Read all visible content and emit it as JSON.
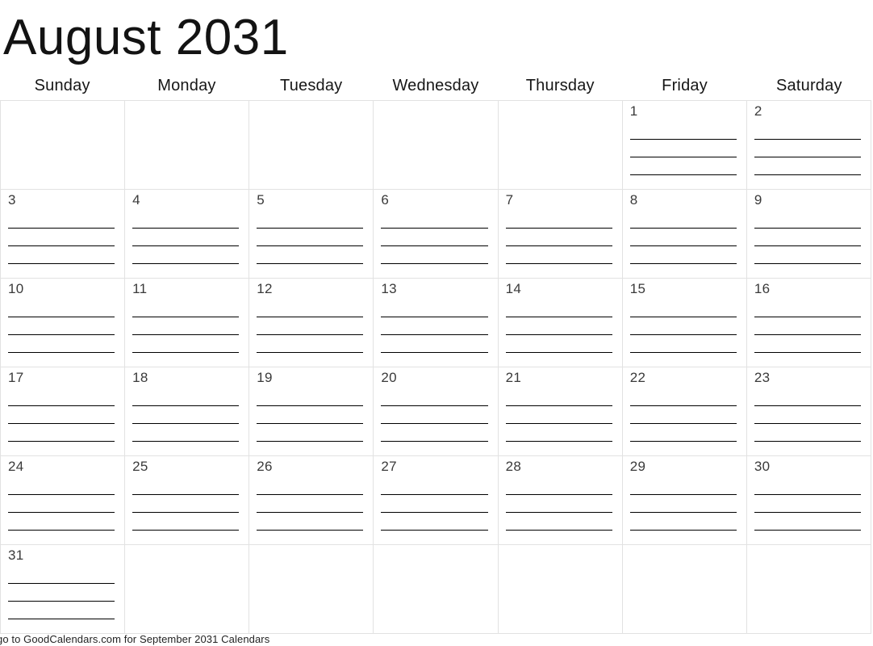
{
  "title": "August 2031",
  "month": "August",
  "year": "2031",
  "weekdays": [
    "Sunday",
    "Monday",
    "Tuesday",
    "Wednesday",
    "Thursday",
    "Friday",
    "Saturday"
  ],
  "grid": {
    "columns": 7,
    "rows": 6,
    "lines_per_cell": 4,
    "border_color": "#e2e2e2",
    "write_line_color": "#000000",
    "weeks": [
      [
        "",
        "",
        "",
        "",
        "",
        "1",
        "2"
      ],
      [
        "3",
        "4",
        "5",
        "6",
        "7",
        "8",
        "9"
      ],
      [
        "10",
        "11",
        "12",
        "13",
        "14",
        "15",
        "16"
      ],
      [
        "17",
        "18",
        "19",
        "20",
        "21",
        "22",
        "23"
      ],
      [
        "24",
        "25",
        "26",
        "27",
        "28",
        "29",
        "30"
      ],
      [
        "31",
        "",
        "",
        "",
        "",
        "",
        ""
      ]
    ]
  },
  "footer": {
    "text": "go to GoodCalendars.com for September 2031 Calendars",
    "site": "GoodCalendars.com",
    "next_month": "September 2031"
  }
}
